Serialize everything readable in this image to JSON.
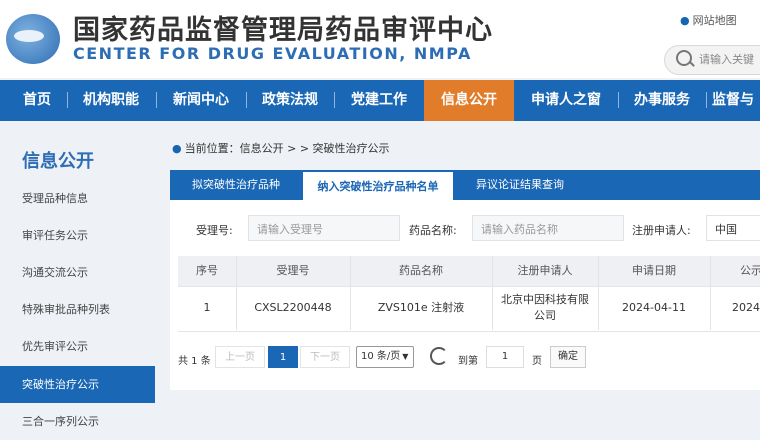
{
  "header": {
    "title_cn": "国家药品监督管理局药品审评中心",
    "title_en": "CENTER FOR DRUG EVALUATION, NMPA",
    "sitemap_label": "网站地图",
    "search_placeholder": "请输入关键"
  },
  "nav": {
    "items": [
      "首页",
      "机构职能",
      "新闻中心",
      "政策法规",
      "党建工作",
      "信息公开",
      "申请人之窗",
      "办事服务",
      "监督与"
    ],
    "active": "信息公开",
    "active_color": "#e07c2a",
    "bar_color": "#1a67b6"
  },
  "sidebar": {
    "title": "信息公开",
    "items": [
      "受理品种信息",
      "审评任务公示",
      "沟通交流公示",
      "特殊审批品种列表",
      "优先审评公示",
      "突破性治疗公示",
      "三合一序列公示"
    ],
    "active": "突破性治疗公示"
  },
  "breadcrumb": {
    "text": "当前位置：信息公开 > > 突破性治疗公示"
  },
  "tabs": {
    "items": [
      "拟突破性治疗品种",
      "纳入突破性治疗品种名单",
      "异议论证结果查询"
    ],
    "active": "纳入突破性治疗品种名单"
  },
  "filters": {
    "acceptance_label": "受理号:",
    "acceptance_placeholder": "请输入受理号",
    "drug_label": "药品名称:",
    "drug_placeholder": "请输入药品名称",
    "applicant_label": "注册申请人:",
    "applicant_value": "中国"
  },
  "table": {
    "headers": [
      "序号",
      "受理号",
      "药品名称",
      "注册申请人",
      "申请日期",
      "公示"
    ],
    "rows": [
      [
        "1",
        "CXSL2200448",
        "ZVS101e 注射液",
        "北京中因科技有限公司",
        "2024-04-11",
        "2024"
      ]
    ]
  },
  "pagination": {
    "total": "共 1 条",
    "prev": "上一页",
    "current_page": "1",
    "next": "下一页",
    "page_size": "10 条/页",
    "goto_label": "到第",
    "goto_value": "1",
    "page_unit": "页",
    "confirm": "确定"
  }
}
